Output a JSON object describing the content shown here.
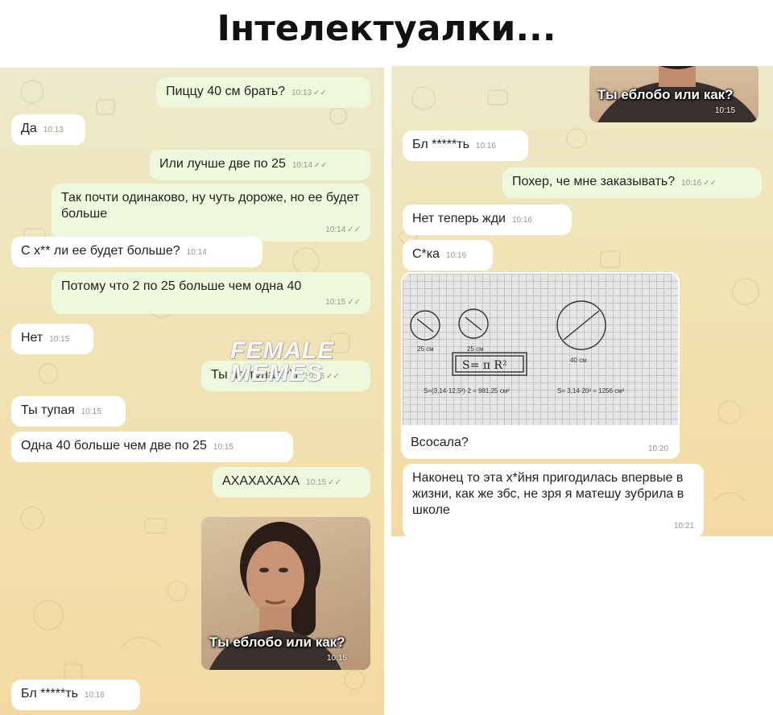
{
  "title": "Інтелектуалки...",
  "watermark": [
    "FEMALE",
    "MEMES"
  ],
  "left": {
    "messages": [
      {
        "text": "Пиццу 40 см брать?",
        "time": "10:13",
        "side": "out"
      },
      {
        "text": "Да",
        "time": "10:13",
        "side": "in"
      },
      {
        "text": "Или лучше две по 25",
        "time": "10:14",
        "side": "out"
      },
      {
        "text": "Так почти одинаково, ну чуть дороже, но ее будет больше",
        "time": "10:14",
        "side": "out"
      },
      {
        "text": "С х** ли ее будет больше?",
        "time": "10:14",
        "side": "in"
      },
      {
        "text": "Потому что 2 по 25 больше чем одна 40",
        "time": "10:15",
        "side": "out"
      },
      {
        "text": "Нет",
        "time": "10:15",
        "side": "in"
      },
      {
        "text": "Ты че тупая?))",
        "time": "10:15",
        "side": "out"
      },
      {
        "text": "Ты тупая",
        "time": "10:15",
        "side": "in"
      },
      {
        "text": "Одна 40 больше чем две по 25",
        "time": "10:15",
        "side": "in"
      },
      {
        "text": "АХАХАХАХА",
        "time": "10:15",
        "side": "out"
      },
      {
        "text": "Бл *****ть",
        "time": "10:16",
        "side": "in"
      }
    ],
    "meme": {
      "caption": "Ты еблобо или как?",
      "time": "10:15"
    }
  },
  "right": {
    "meme": {
      "caption": "Ты еблобо или как?",
      "time": "10:15"
    },
    "messages": [
      {
        "text": "Бл *****ть",
        "time": "10:16",
        "side": "in"
      },
      {
        "text": "Похер, че мне заказывать?",
        "time": "10:16",
        "side": "out"
      },
      {
        "text": "Нет теперь жди",
        "time": "10:16",
        "side": "in"
      },
      {
        "text": "С*ка",
        "time": "10:16",
        "side": "in"
      },
      {
        "text": "Всосала?",
        "time": "10:20",
        "side": "in"
      },
      {
        "text": "Наконец то эта х*йня пригодилась впервые в жизни, как же збс, не зря я матешу зубрила в школе",
        "time": "10:21",
        "side": "in"
      }
    ],
    "sketch": {
      "d1": "25 см",
      "d2": "25 см",
      "d3": "40 см",
      "formula": "S= π R²",
      "calc1": "S=(3,14·12,5²)·2 = 981,25 см²",
      "calc2": "S= 3,14·20² = 1256 см²"
    }
  }
}
